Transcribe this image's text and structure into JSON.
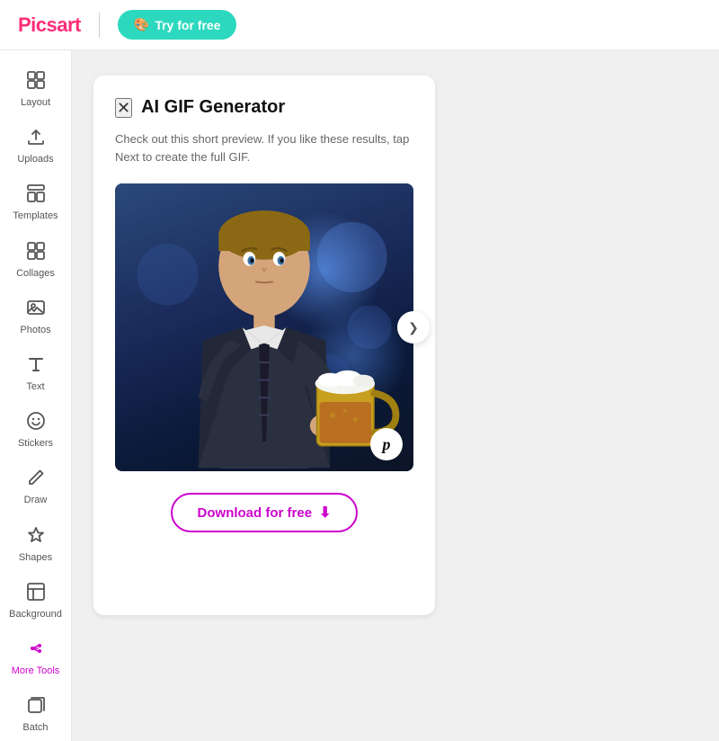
{
  "header": {
    "logo": "Picsart",
    "divider": true,
    "try_btn_label": "Try for free",
    "try_btn_icon": "🎨"
  },
  "sidebar": {
    "items": [
      {
        "id": "layout",
        "label": "Layout",
        "icon": "⊞",
        "active": false
      },
      {
        "id": "uploads",
        "label": "Uploads",
        "icon": "⬆",
        "active": false
      },
      {
        "id": "templates",
        "label": "Templates",
        "icon": "☰",
        "active": false
      },
      {
        "id": "collages",
        "label": "Collages",
        "icon": "⊞",
        "active": false
      },
      {
        "id": "photos",
        "label": "Photos",
        "icon": "🖼",
        "active": false
      },
      {
        "id": "text",
        "label": "Text",
        "icon": "T",
        "active": false
      },
      {
        "id": "stickers",
        "label": "Stickers",
        "icon": "😊",
        "active": false
      },
      {
        "id": "draw",
        "label": "Draw",
        "icon": "✏",
        "active": false
      },
      {
        "id": "shapes",
        "label": "Shapes",
        "icon": "★",
        "active": false
      },
      {
        "id": "background",
        "label": "Background",
        "icon": "▣",
        "active": false
      },
      {
        "id": "more-tools",
        "label": "More Tools",
        "icon": "⊕",
        "active": true
      },
      {
        "id": "batch",
        "label": "Batch",
        "icon": "⊡",
        "active": false
      }
    ]
  },
  "panel": {
    "close_icon": "✕",
    "title": "AI GIF Generator",
    "description": "Check out this short preview. If you like these results, tap Next to create the full GIF.",
    "picsart_badge": "p",
    "arrow_icon": "❯",
    "download_label": "Download for free",
    "download_icon": "⬇"
  }
}
